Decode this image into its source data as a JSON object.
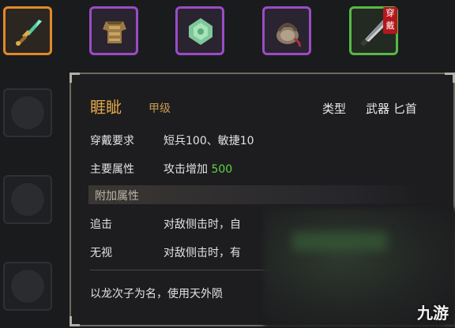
{
  "equip_row": {
    "equipped_badge": "穿戴"
  },
  "tooltip": {
    "name": "睚眦",
    "grade": "甲级",
    "type_label": "类型",
    "type_value": "武器 匕首",
    "requirement_label": "穿戴要求",
    "requirement_value": "短兵100、敏捷10",
    "main_attr_label": "主要属性",
    "main_attr_text": "攻击增加",
    "main_attr_value": "500",
    "extra_section": "附加属性",
    "extra": [
      {
        "name": "追击",
        "text": "对敌侧击时，自"
      },
      {
        "name": "无视",
        "text": "对敌侧击时，有"
      }
    ],
    "description": "以龙次子为名，使用天外陨"
  },
  "watermark": "九游",
  "colors": {
    "orange_quality": "#e08a2a",
    "purple_quality": "#9a4cc6",
    "green_quality": "#58b848",
    "title_gold": "#e3a74a",
    "value_green": "#5ed34a",
    "badge_red": "#b3171c"
  }
}
